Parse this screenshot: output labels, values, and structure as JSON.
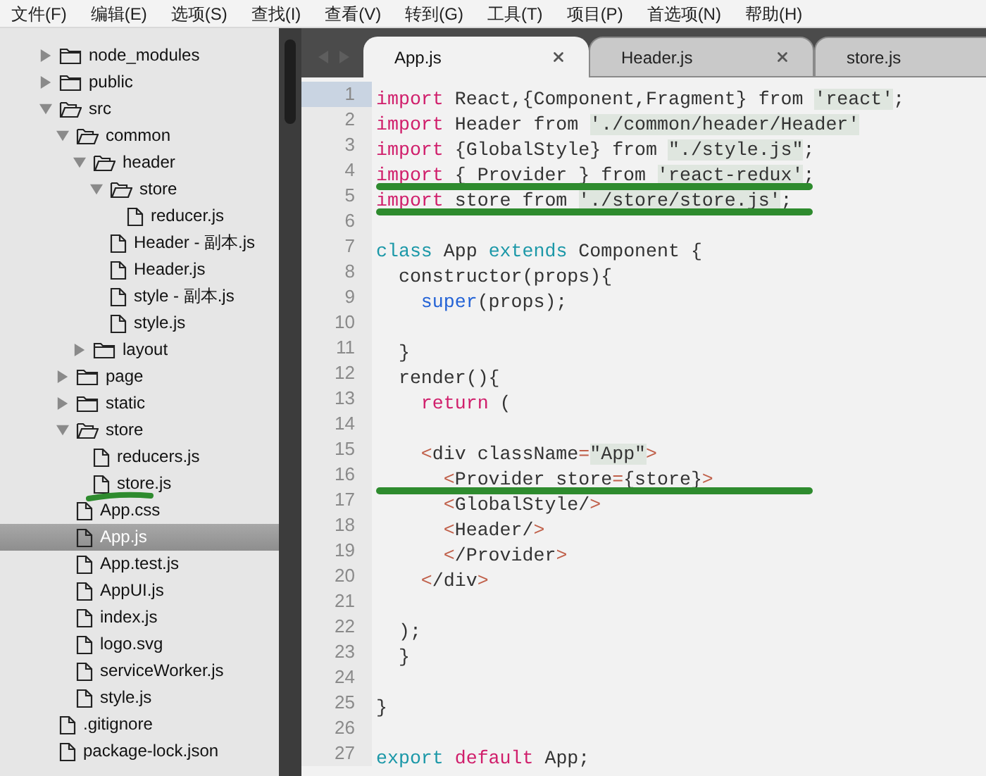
{
  "menu": [
    "文件(F)",
    "编辑(E)",
    "选项(S)",
    "查找(I)",
    "查看(V)",
    "转到(G)",
    "工具(T)",
    "项目(P)",
    "首选项(N)",
    "帮助(H)"
  ],
  "sidebar": {
    "tree": [
      {
        "name": "node_modules",
        "kind": "folder",
        "expanded": false,
        "selected": false,
        "underlined": false
      },
      {
        "name": "public",
        "kind": "folder",
        "expanded": false,
        "selected": false,
        "underlined": false
      },
      {
        "name": "src",
        "kind": "folder",
        "expanded": true,
        "selected": false,
        "underlined": false,
        "children": [
          {
            "name": "common",
            "kind": "folder",
            "expanded": true,
            "selected": false,
            "underlined": false,
            "children": [
              {
                "name": "header",
                "kind": "folder",
                "expanded": true,
                "selected": false,
                "underlined": false,
                "children": [
                  {
                    "name": "store",
                    "kind": "folder",
                    "expanded": true,
                    "selected": false,
                    "underlined": false,
                    "children": [
                      {
                        "name": "reducer.js",
                        "kind": "file",
                        "selected": false,
                        "underlined": false
                      }
                    ]
                  },
                  {
                    "name": "Header - 副本.js",
                    "kind": "file",
                    "selected": false,
                    "underlined": false
                  },
                  {
                    "name": "Header.js",
                    "kind": "file",
                    "selected": false,
                    "underlined": false
                  },
                  {
                    "name": "style - 副本.js",
                    "kind": "file",
                    "selected": false,
                    "underlined": false
                  },
                  {
                    "name": "style.js",
                    "kind": "file",
                    "selected": false,
                    "underlined": false
                  }
                ]
              },
              {
                "name": "layout",
                "kind": "folder",
                "expanded": false,
                "selected": false,
                "underlined": false
              }
            ]
          },
          {
            "name": "page",
            "kind": "folder",
            "expanded": false,
            "selected": false,
            "underlined": false
          },
          {
            "name": "static",
            "kind": "folder",
            "expanded": false,
            "selected": false,
            "underlined": false
          },
          {
            "name": "store",
            "kind": "folder",
            "expanded": true,
            "selected": false,
            "underlined": false,
            "children": [
              {
                "name": "reducers.js",
                "kind": "file",
                "selected": false,
                "underlined": false
              },
              {
                "name": "store.js",
                "kind": "file",
                "selected": false,
                "underlined": true
              }
            ]
          },
          {
            "name": "App.css",
            "kind": "file",
            "selected": false,
            "underlined": false
          },
          {
            "name": "App.js",
            "kind": "file",
            "selected": true,
            "underlined": false
          },
          {
            "name": "App.test.js",
            "kind": "file",
            "selected": false,
            "underlined": false
          },
          {
            "name": "AppUI.js",
            "kind": "file",
            "selected": false,
            "underlined": false
          },
          {
            "name": "index.js",
            "kind": "file",
            "selected": false,
            "underlined": false
          },
          {
            "name": "logo.svg",
            "kind": "file",
            "selected": false,
            "underlined": false
          },
          {
            "name": "serviceWorker.js",
            "kind": "file",
            "selected": false,
            "underlined": false
          },
          {
            "name": "style.js",
            "kind": "file",
            "selected": false,
            "underlined": false
          }
        ]
      },
      {
        "name": ".gitignore",
        "kind": "file",
        "selected": false,
        "underlined": false
      },
      {
        "name": "package-lock.json",
        "kind": "file",
        "selected": false,
        "underlined": false
      }
    ]
  },
  "tabs": [
    {
      "label": "App.js",
      "selected": true
    },
    {
      "label": "Header.js",
      "selected": false
    },
    {
      "label": "store.js",
      "selected": false
    }
  ],
  "editor": {
    "lines": [
      {
        "number": "1",
        "current": true,
        "underlined": false,
        "tokens": [
          {
            "kind": "kw",
            "text": "import"
          },
          {
            "kind": "pl",
            "text": " React,{Component,Fragment} from "
          },
          {
            "kind": "str",
            "text": "'react'"
          },
          {
            "kind": "pl",
            "text": ";"
          }
        ]
      },
      {
        "number": "2",
        "current": false,
        "underlined": false,
        "tokens": [
          {
            "kind": "kw",
            "text": "import"
          },
          {
            "kind": "pl",
            "text": " Header from "
          },
          {
            "kind": "str",
            "text": "'./common/header/Header'"
          }
        ]
      },
      {
        "number": "3",
        "current": false,
        "underlined": false,
        "tokens": [
          {
            "kind": "kw",
            "text": "import"
          },
          {
            "kind": "pl",
            "text": " {GlobalStyle} from "
          },
          {
            "kind": "str",
            "text": "\"./style.js\""
          },
          {
            "kind": "pl",
            "text": ";"
          }
        ]
      },
      {
        "number": "4",
        "current": false,
        "underlined": true,
        "tokens": [
          {
            "kind": "kw",
            "text": "import"
          },
          {
            "kind": "pl",
            "text": " { Provider } from "
          },
          {
            "kind": "str",
            "text": "'react-redux'"
          },
          {
            "kind": "pl",
            "text": ";"
          }
        ]
      },
      {
        "number": "5",
        "current": false,
        "underlined": true,
        "tokens": [
          {
            "kind": "kw",
            "text": "import"
          },
          {
            "kind": "pl",
            "text": " store from "
          },
          {
            "kind": "str",
            "text": "'./store/store.js'"
          },
          {
            "kind": "pl",
            "text": ";"
          }
        ]
      },
      {
        "number": "6",
        "current": false,
        "underlined": false
      },
      {
        "number": "7",
        "current": false,
        "underlined": false,
        "tokens": [
          {
            "kind": "dec",
            "text": "class"
          },
          {
            "kind": "pl",
            "text": " App "
          },
          {
            "kind": "dec",
            "text": "extends"
          },
          {
            "kind": "pl",
            "text": " Component {"
          }
        ]
      },
      {
        "number": "8",
        "current": false,
        "underlined": false,
        "tokens": [
          {
            "kind": "pl",
            "text": "  constructor(props){"
          }
        ]
      },
      {
        "number": "9",
        "current": false,
        "underlined": false,
        "tokens": [
          {
            "kind": "fn",
            "text": "    super"
          },
          {
            "kind": "pl",
            "text": "(props);"
          }
        ]
      },
      {
        "number": "10",
        "current": false,
        "underlined": false
      },
      {
        "number": "11",
        "current": false,
        "underlined": false,
        "tokens": [
          {
            "kind": "pl",
            "text": "  }"
          }
        ]
      },
      {
        "number": "12",
        "current": false,
        "underlined": false,
        "tokens": [
          {
            "kind": "pl",
            "text": "  render(){"
          }
        ]
      },
      {
        "number": "13",
        "current": false,
        "underlined": false,
        "tokens": [
          {
            "kind": "kw",
            "text": "    return"
          },
          {
            "kind": "pl",
            "text": " ("
          }
        ]
      },
      {
        "number": "14",
        "current": false,
        "underlined": false
      },
      {
        "number": "15",
        "current": false,
        "underlined": false,
        "tokens": [
          {
            "kind": "tag",
            "text": "    <"
          },
          {
            "kind": "pl",
            "text": "div className"
          },
          {
            "kind": "tag",
            "text": "="
          },
          {
            "kind": "str",
            "text": "\"App\""
          },
          {
            "kind": "tag",
            "text": ">"
          }
        ]
      },
      {
        "number": "16",
        "current": false,
        "underlined": true,
        "tokens": [
          {
            "kind": "tag",
            "text": "      <"
          },
          {
            "kind": "pl",
            "text": "Provider store"
          },
          {
            "kind": "tag",
            "text": "="
          },
          {
            "kind": "pl",
            "text": "{store}"
          },
          {
            "kind": "tag",
            "text": ">"
          }
        ]
      },
      {
        "number": "17",
        "current": false,
        "underlined": false,
        "tokens": [
          {
            "kind": "tag",
            "text": "      <"
          },
          {
            "kind": "pl",
            "text": "GlobalStyle/"
          },
          {
            "kind": "tag",
            "text": ">"
          }
        ]
      },
      {
        "number": "18",
        "current": false,
        "underlined": false,
        "tokens": [
          {
            "kind": "tag",
            "text": "      <"
          },
          {
            "kind": "pl",
            "text": "Header/"
          },
          {
            "kind": "tag",
            "text": ">"
          }
        ]
      },
      {
        "number": "19",
        "current": false,
        "underlined": false,
        "tokens": [
          {
            "kind": "tag",
            "text": "      <"
          },
          {
            "kind": "pl",
            "text": "/Provider"
          },
          {
            "kind": "tag",
            "text": ">"
          }
        ]
      },
      {
        "number": "20",
        "current": false,
        "underlined": false,
        "tokens": [
          {
            "kind": "tag",
            "text": "    <"
          },
          {
            "kind": "pl",
            "text": "/div"
          },
          {
            "kind": "tag",
            "text": ">"
          }
        ]
      },
      {
        "number": "21",
        "current": false,
        "underlined": false
      },
      {
        "number": "22",
        "current": false,
        "underlined": false,
        "tokens": [
          {
            "kind": "pl",
            "text": "  );"
          }
        ]
      },
      {
        "number": "23",
        "current": false,
        "underlined": false,
        "tokens": [
          {
            "kind": "pl",
            "text": "  }"
          }
        ]
      },
      {
        "number": "24",
        "current": false,
        "underlined": false
      },
      {
        "number": "25",
        "current": false,
        "underlined": false,
        "tokens": [
          {
            "kind": "pl",
            "text": "}"
          }
        ]
      },
      {
        "number": "26",
        "current": false,
        "underlined": false
      },
      {
        "number": "27",
        "current": false,
        "underlined": false,
        "tokens": [
          {
            "kind": "dec",
            "text": "export"
          },
          {
            "kind": "kw",
            "text": " default"
          },
          {
            "kind": "pl",
            "text": " App;"
          }
        ]
      }
    ]
  }
}
